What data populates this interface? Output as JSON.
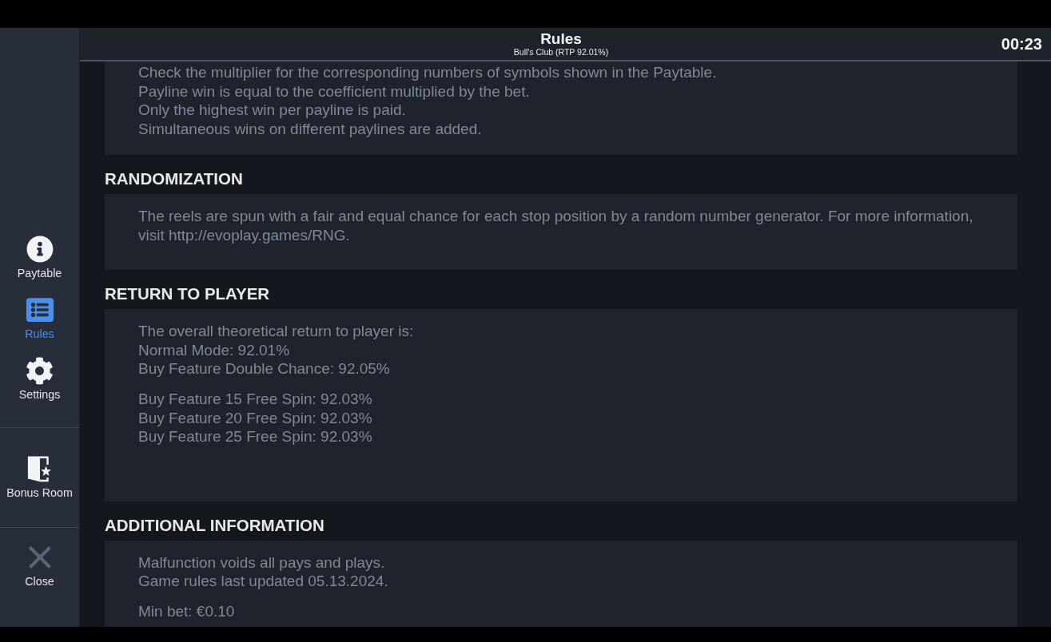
{
  "window": {
    "title": "Rules",
    "subtitle": "Bull's Club (RTP 92.01%)",
    "timer": "00:23"
  },
  "sidebar": {
    "groups": [
      {
        "items": [
          {
            "label": "Paytable",
            "selected": false
          },
          {
            "label": "Rules",
            "selected": true
          },
          {
            "label": "Settings",
            "selected": false
          }
        ]
      },
      {
        "items": [
          {
            "label": "Bonus Room",
            "selected": false
          }
        ]
      },
      {
        "items": [
          {
            "label": "Close",
            "selected": false
          }
        ]
      }
    ]
  },
  "sections": [
    {
      "paragraphs": [
        [
          "Check the multiplier for the corresponding numbers of symbols shown in the Paytable.",
          "Payline win is equal to the coefficient multiplied by the bet.",
          "Only the highest win per payline is paid.",
          "Simultaneous wins on different paylines are added."
        ]
      ]
    },
    {
      "heading": "RANDOMIZATION",
      "paragraphs": [
        [
          "The reels are spun with a fair and equal chance for each stop position by a random number generator. For more information, visit http://evoplay.games/RNG."
        ]
      ]
    },
    {
      "heading": "RETURN TO PLAYER",
      "paragraphs": [
        [
          "The overall theoretical return to player is:",
          "Normal Mode: 92.01%",
          "Buy Feature Double Chance: 92.05%"
        ],
        [
          "Buy Feature 15 Free Spin: 92.03%",
          "Buy Feature 20 Free Spin: 92.03%",
          "Buy Feature 25 Free Spin: 92.03%"
        ]
      ]
    },
    {
      "heading": "ADDITIONAL INFORMATION",
      "paragraphs": [
        [
          "Malfunction voids all pays and plays.",
          "Game rules last updated 05.13.2024."
        ],
        [
          "Min bet: €0.10"
        ]
      ]
    }
  ]
}
